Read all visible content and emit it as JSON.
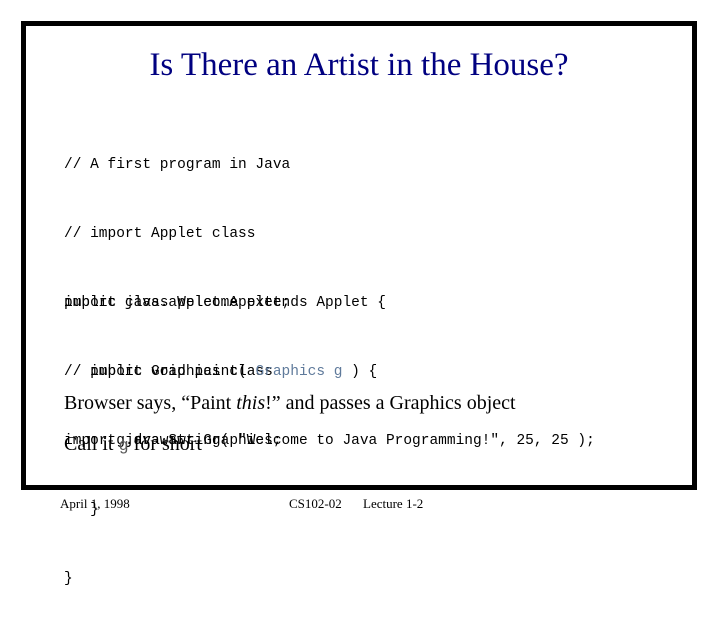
{
  "slide": {
    "title": "Is There an Artist in the House?",
    "title_color": "#000080",
    "border_color": "#000000",
    "background_color": "#ffffff"
  },
  "code": {
    "imports_block": {
      "lines": [
        "// A first program in Java",
        "// import Applet class",
        "import java.applet.Applet;",
        "// import Graphics class",
        "import java.awt.Graphics;"
      ]
    },
    "class_block": {
      "line1": "public class Welcome extends Applet {",
      "line2_pre": "   public void paint( ",
      "line2_type": "Graphics g",
      "line2_post": " ) {",
      "line3": "      g.drawString( \"Welcome to Java Programming!\", 25, 25 );",
      "line4": "   }",
      "line5": "}"
    },
    "type_highlight_color": "#5f7a9b",
    "text_color": "#000000"
  },
  "prose": {
    "line1_part1": "Browser says, “Paint ",
    "line1_italic": "this",
    "line1_part2": "!” and passes a Graphics object",
    "line2_part1": "Call it ",
    "line2_mono": "g",
    "line2_part2": " for short"
  },
  "footer": {
    "date": "April 1, 1998",
    "course": "CS102-02",
    "lecture": "Lecture 1-2"
  }
}
